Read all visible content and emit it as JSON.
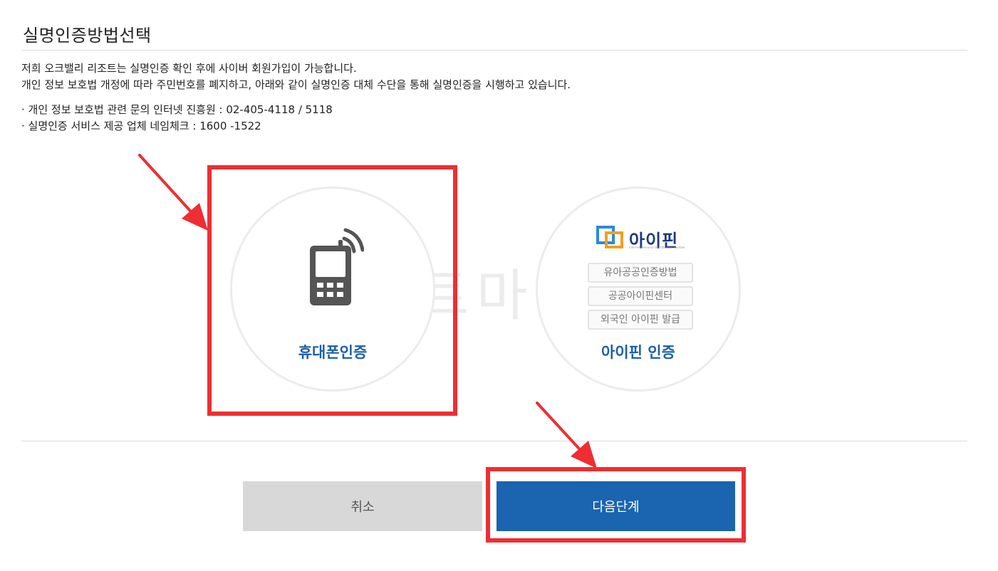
{
  "page": {
    "title": "실명인증방법선택"
  },
  "intro": {
    "line1": "저희 오크밸리 리조트는 실명인증 확인 후에 사이버 회원가입이 가능합니다.",
    "line2": "개인 정보 보호법 개정에 따라 주민번호를 폐지하고, 아래와 같이 실명인증 대체 수단을 통해 실명인증을 시행하고 있습니다."
  },
  "contacts": {
    "line1": "· 개인 정보 보호법 관련 문의 인터넷 진흥원 : 02-405-4118 / 5118",
    "line2": "· 실명인증 서비스 제공 업체 네임체크 : 1600 -1522"
  },
  "watermark": "노트마니아",
  "methods": {
    "phone": {
      "label": "휴대폰인증",
      "icon": "mobile-phone-icon"
    },
    "ipin": {
      "label": "아이핀 인증",
      "logo_text": "아이핀",
      "logo_sub": "Internet Personal Identification Number",
      "buttons": [
        "유아공공인증방법",
        "공공아이핀센터",
        "외국인 아이핀 발급"
      ]
    }
  },
  "actions": {
    "cancel_label": "취소",
    "next_label": "다음단계"
  },
  "colors": {
    "accent": "#1a64b0",
    "highlight": "#ee2e33",
    "label_blue": "#1c5fa8",
    "cancel_bg": "#d8d8d8"
  }
}
